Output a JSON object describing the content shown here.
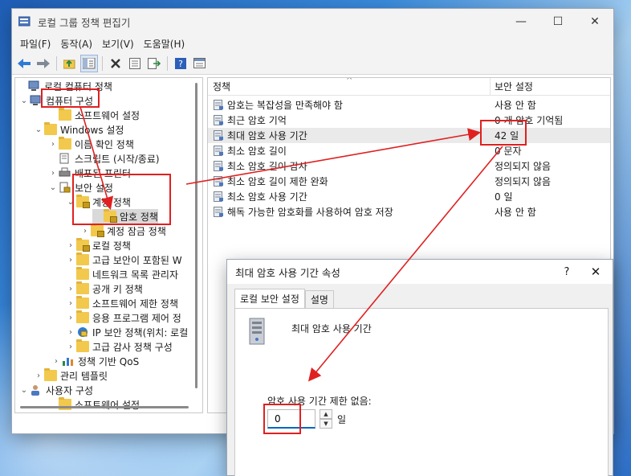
{
  "window": {
    "title": "로컬 그룹 정책 편집기",
    "controls": {
      "minimize": "—",
      "maximize": "☐",
      "close": "✕"
    }
  },
  "menu": [
    "파일(F)",
    "동작(A)",
    "보기(V)",
    "도움말(H)"
  ],
  "tree": [
    {
      "label": "로컬 컴퓨터 정책",
      "chevron": "",
      "icon": "computer-icon"
    },
    {
      "label": "컴퓨터 구성",
      "chevron": "⌄",
      "icon": "computer-icon"
    },
    {
      "label": "소프트웨어 설정",
      "chevron": "",
      "icon": "folder-icon"
    },
    {
      "label": "Windows 설정",
      "chevron": "⌄",
      "icon": "folder-icon"
    },
    {
      "label": "이름 확인 정책",
      "chevron": "›",
      "icon": "folder-icon"
    },
    {
      "label": "스크립트 (시작/종료)",
      "chevron": "",
      "icon": "script-icon"
    },
    {
      "label": "배포된 프린터",
      "chevron": "›",
      "icon": "printer-icon"
    },
    {
      "label": "보안 설정",
      "chevron": "⌄",
      "icon": "security-icon"
    },
    {
      "label": "계정 정책",
      "chevron": "⌄",
      "icon": "lock-folder-icon"
    },
    {
      "label": "암호 정책",
      "chevron": "",
      "icon": "lock-folder-icon"
    },
    {
      "label": "계정 잠금 정책",
      "chevron": "›",
      "icon": "lock-folder-icon"
    },
    {
      "label": "로컬 정책",
      "chevron": "›",
      "icon": "lock-folder-icon"
    },
    {
      "label": "고급 보안이 포함된 W",
      "chevron": "›",
      "icon": "folder-icon"
    },
    {
      "label": "네트워크 목록 관리자",
      "chevron": "",
      "icon": "folder-icon"
    },
    {
      "label": "공개 키 정책",
      "chevron": "›",
      "icon": "folder-icon"
    },
    {
      "label": "소프트웨어 제한 정책",
      "chevron": "›",
      "icon": "folder-icon"
    },
    {
      "label": "응용 프로그램 제어 정",
      "chevron": "›",
      "icon": "folder-icon"
    },
    {
      "label": "IP 보안 정책(위치: 로컬",
      "chevron": "›",
      "icon": "ipsec-icon"
    },
    {
      "label": "고급 감사 정책 구성",
      "chevron": "›",
      "icon": "folder-icon"
    },
    {
      "label": "정책 기반 QoS",
      "chevron": "›",
      "icon": "chart-icon"
    },
    {
      "label": "관리 템플릿",
      "chevron": "›",
      "icon": "folder-icon"
    },
    {
      "label": "사용자 구성",
      "chevron": "⌄",
      "icon": "user-icon"
    },
    {
      "label": "소프트웨어 설정",
      "chevron": "",
      "icon": "folder-icon"
    }
  ],
  "list": {
    "col_policy": "정책",
    "col_setting": "보안 설정",
    "sort_glyph": "^",
    "rows": [
      {
        "name": "암호는 복잡성을 만족해야 함",
        "value": "사용 안 함"
      },
      {
        "name": "최근 암호 기억",
        "value": "0 개 암호 기억됨"
      },
      {
        "name": "최대 암호 사용 기간",
        "value": "42 일"
      },
      {
        "name": "최소 암호 길이",
        "value": "0 문자"
      },
      {
        "name": "최소 암호 길이 감사",
        "value": "정의되지 않음"
      },
      {
        "name": "최소 암호 길이 제한 완화",
        "value": "정의되지 않음"
      },
      {
        "name": "최소 암호 사용 기간",
        "value": "0 일"
      },
      {
        "name": "해독 가능한 암호화를 사용하여 암호 저장",
        "value": "사용 안 함"
      }
    ]
  },
  "dialog": {
    "title": "최대 암호 사용 기간 속성",
    "help": "?",
    "close": "✕",
    "tabs": [
      "로컬 보안 설정",
      "설명"
    ],
    "policy_name": "최대 암호 사용 기간",
    "field_label": "암호 사용 기간 제한 없음:",
    "field_value": "0",
    "spin_up": "▲",
    "spin_down": "▼",
    "unit": "일"
  },
  "colors": {
    "annotation": "#e02020",
    "accent": "#0067c0"
  }
}
